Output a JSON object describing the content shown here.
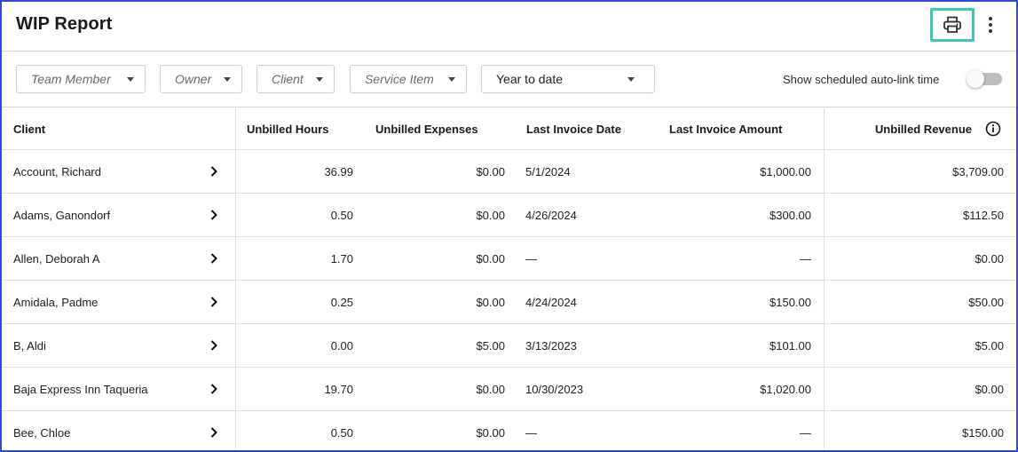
{
  "header": {
    "title": "WIP Report",
    "print_icon": "printer-icon",
    "more_icon": "more-vertical-icon",
    "accent_highlight": "#3cc7b9"
  },
  "filters": {
    "team_member": "Team Member",
    "owner": "Owner",
    "client": "Client",
    "service_item": "Service Item",
    "date_range": "Year to date",
    "toggle_label": "Show scheduled auto-link time",
    "toggle_on": false
  },
  "table": {
    "columns": {
      "client": "Client",
      "unbilled_hours": "Unbilled Hours",
      "unbilled_expenses": "Unbilled Expenses",
      "last_invoice_date": "Last Invoice Date",
      "last_invoice_amount": "Last Invoice Amount",
      "unbilled_revenue": "Unbilled Revenue"
    },
    "rows": [
      {
        "client": "Account, Richard",
        "hours": "36.99",
        "expenses": "$0.00",
        "date": "5/1/2024",
        "amount": "$1,000.00",
        "revenue": "$3,709.00"
      },
      {
        "client": "Adams, Ganondorf",
        "hours": "0.50",
        "expenses": "$0.00",
        "date": "4/26/2024",
        "amount": "$300.00",
        "revenue": "$112.50"
      },
      {
        "client": "Allen, Deborah A",
        "hours": "1.70",
        "expenses": "$0.00",
        "date": "—",
        "amount": "—",
        "revenue": "$0.00"
      },
      {
        "client": "Amidala, Padme",
        "hours": "0.25",
        "expenses": "$0.00",
        "date": "4/24/2024",
        "amount": "$150.00",
        "revenue": "$50.00"
      },
      {
        "client": "B, Aldi",
        "hours": "0.00",
        "expenses": "$5.00",
        "date": "3/13/2023",
        "amount": "$101.00",
        "revenue": "$5.00"
      },
      {
        "client": "Baja Express Inn Taqueria",
        "hours": "19.70",
        "expenses": "$0.00",
        "date": "10/30/2023",
        "amount": "$1,020.00",
        "revenue": "$0.00"
      },
      {
        "client": "Bee, Chloe",
        "hours": "0.50",
        "expenses": "$0.00",
        "date": "—",
        "amount": "—",
        "revenue": "$150.00"
      }
    ]
  }
}
